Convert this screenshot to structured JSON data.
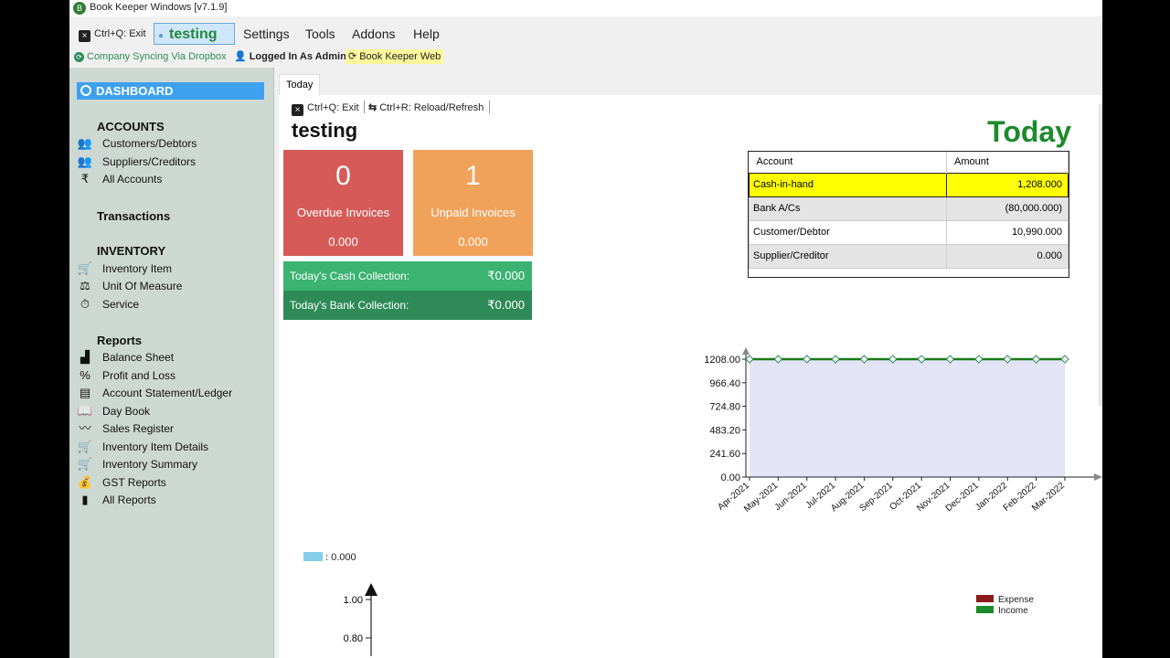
{
  "window": {
    "title": "Book Keeper Windows [v7.1.9]"
  },
  "menubar": {
    "exit": "Ctrl+Q: Exit",
    "company": "testing",
    "items": [
      "Settings",
      "Tools",
      "Addons",
      "Help"
    ]
  },
  "statusbar": {
    "sync": "Company Syncing Via Dropbox",
    "logged_in": "Logged In As Admin",
    "web": "Book Keeper Web"
  },
  "sidebar": {
    "dashboard": "DASHBOARD",
    "accounts_heading": "ACCOUNTS",
    "accounts": [
      "Customers/Debtors",
      "Suppliers/Creditors",
      "All Accounts"
    ],
    "transactions_heading": "Transactions",
    "inventory_heading": "INVENTORY",
    "inventory": [
      "Inventory Item",
      "Unit Of Measure",
      "Service"
    ],
    "reports_heading": "Reports",
    "reports": [
      "Balance Sheet",
      "Profit and Loss",
      "Account Statement/Ledger",
      "Day Book",
      "Sales Register",
      "Inventory Item Details",
      "Inventory Summary",
      "GST Reports",
      "All Reports"
    ]
  },
  "tabs": {
    "today": "Today"
  },
  "toolbar": {
    "exit": "Ctrl+Q: Exit",
    "reload": "Ctrl+R: Reload/Refresh"
  },
  "dashboard": {
    "company_name": "testing",
    "today_heading": "Today",
    "overdue": {
      "count": "0",
      "label": "Overdue Invoices",
      "amount": "0.000"
    },
    "unpaid": {
      "count": "1",
      "label": "Unpaid Invoices",
      "amount": "0.000"
    },
    "cash_collection": {
      "label": "Today's Cash Collection:",
      "value": "₹0.000"
    },
    "bank_collection": {
      "label": "Today's Bank Collection:",
      "value": "₹0.000"
    },
    "accounts_table": {
      "headers": [
        "Account",
        "Amount"
      ],
      "rows": [
        [
          "Cash-in-hand",
          "1,208.000"
        ],
        [
          "Bank A/Cs",
          "(80,000.000)"
        ],
        [
          "Customer/Debtor",
          "10,990.000"
        ],
        [
          "Supplier/Creditor",
          "0.000"
        ]
      ]
    },
    "small_legend": ": 0.000",
    "axis2_ticks": [
      "1.00",
      "0.80"
    ],
    "legend_ie": [
      {
        "label": "Expense",
        "color": "#8b1a1a"
      },
      {
        "label": "Income",
        "color": "#1a8a2a"
      }
    ]
  },
  "chart_data": {
    "type": "area",
    "x": [
      "Apr-2021",
      "May-2021",
      "Jun-2021",
      "Jul-2021",
      "Aug-2021",
      "Sep-2021",
      "Oct-2021",
      "Nov-2021",
      "Dec-2021",
      "Jan-2022",
      "Feb-2022",
      "Mar-2022"
    ],
    "series": [
      {
        "values": [
          1208,
          1208,
          1208,
          1208,
          1208,
          1208,
          1208,
          1208,
          1208,
          1208,
          1208,
          1208
        ],
        "line_color": "#1a7a1a",
        "fill_color": "#e3e4f5"
      }
    ],
    "y_ticks": [
      "1208.00",
      "966.40",
      "724.80",
      "483.20",
      "241.60",
      "0.00"
    ],
    "ylim": [
      0,
      1208
    ]
  }
}
